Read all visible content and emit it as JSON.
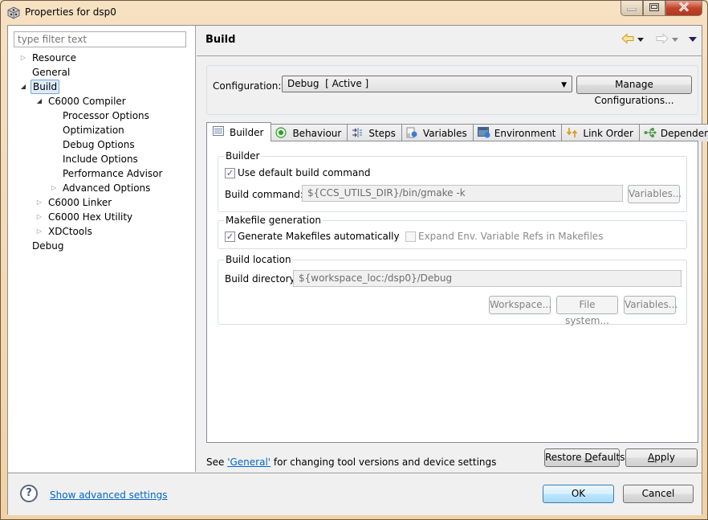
{
  "window": {
    "title": "Properties for dsp0",
    "controls": {
      "minimize": "minimize",
      "maximize": "maximize",
      "close": "close"
    }
  },
  "sidebar": {
    "filter_placeholder": "type filter text",
    "tree": [
      {
        "label": "Resource",
        "level": 0,
        "expander": "collapsed"
      },
      {
        "label": "General",
        "level": 0,
        "expander": "none"
      },
      {
        "label": "Build",
        "level": 0,
        "expander": "expanded",
        "selected": true
      },
      {
        "label": "C6000 Compiler",
        "level": 1,
        "expander": "expanded"
      },
      {
        "label": "Processor Options",
        "level": 2,
        "expander": "none"
      },
      {
        "label": "Optimization",
        "level": 2,
        "expander": "none"
      },
      {
        "label": "Debug Options",
        "level": 2,
        "expander": "none"
      },
      {
        "label": "Include Options",
        "level": 2,
        "expander": "none"
      },
      {
        "label": "Performance Advisor",
        "level": 2,
        "expander": "none"
      },
      {
        "label": "Advanced Options",
        "level": 2,
        "expander": "collapsed"
      },
      {
        "label": "C6000 Linker",
        "level": 1,
        "expander": "collapsed"
      },
      {
        "label": "C6000 Hex Utility",
        "level": 1,
        "expander": "collapsed"
      },
      {
        "label": "XDCtools",
        "level": 1,
        "expander": "collapsed"
      },
      {
        "label": "Debug",
        "level": 0,
        "expander": "none"
      }
    ]
  },
  "page": {
    "title": "Build",
    "nav": {
      "back": "back-arrow",
      "forward": "forward-arrow",
      "menu": "view-menu"
    },
    "configuration": {
      "label": "Configuration:",
      "value": "Debug  [ Active ]",
      "manage_button": "Manage Configurations..."
    },
    "tabs": [
      {
        "label": "Builder",
        "icon": "builder-icon",
        "active": true
      },
      {
        "label": "Behaviour",
        "icon": "behaviour-icon"
      },
      {
        "label": "Steps",
        "icon": "steps-icon"
      },
      {
        "label": "Variables",
        "icon": "variables-icon"
      },
      {
        "label": "Environment",
        "icon": "environment-icon"
      },
      {
        "label": "Link Order",
        "icon": "link-order-icon"
      },
      {
        "label": "Dependencies",
        "icon": "dependencies-icon"
      }
    ],
    "builder_group": {
      "title": "Builder",
      "use_default_label": "Use default build command",
      "use_default_checked": true,
      "build_command_label": "Build command:",
      "build_command_value": "${CCS_UTILS_DIR}/bin/gmake -k",
      "variables_button": "Variables..."
    },
    "makefile_group": {
      "title": "Makefile generation",
      "generate_label": "Generate Makefiles automatically",
      "generate_checked": true,
      "expand_label": "Expand Env. Variable Refs in Makefiles",
      "expand_checked": false
    },
    "location_group": {
      "title": "Build location",
      "directory_label": "Build directory:",
      "directory_value": "${workspace_loc:/dsp0}/Debug",
      "workspace_button": "Workspace...",
      "filesystem_button": "File system...",
      "variables_button": "Variables..."
    },
    "footer": {
      "note_prefix": "See ",
      "note_link": "'General'",
      "note_suffix": " for changing tool versions and device settings",
      "restore_prefix": "Restore ",
      "restore_mnemonic": "D",
      "restore_suffix": "efaults",
      "apply_mnemonic": "A",
      "apply_suffix": "pply"
    }
  },
  "bottom": {
    "help_icon": "?",
    "advanced_link": "Show advanced settings",
    "ok_button": "OK",
    "cancel_button": "Cancel"
  }
}
